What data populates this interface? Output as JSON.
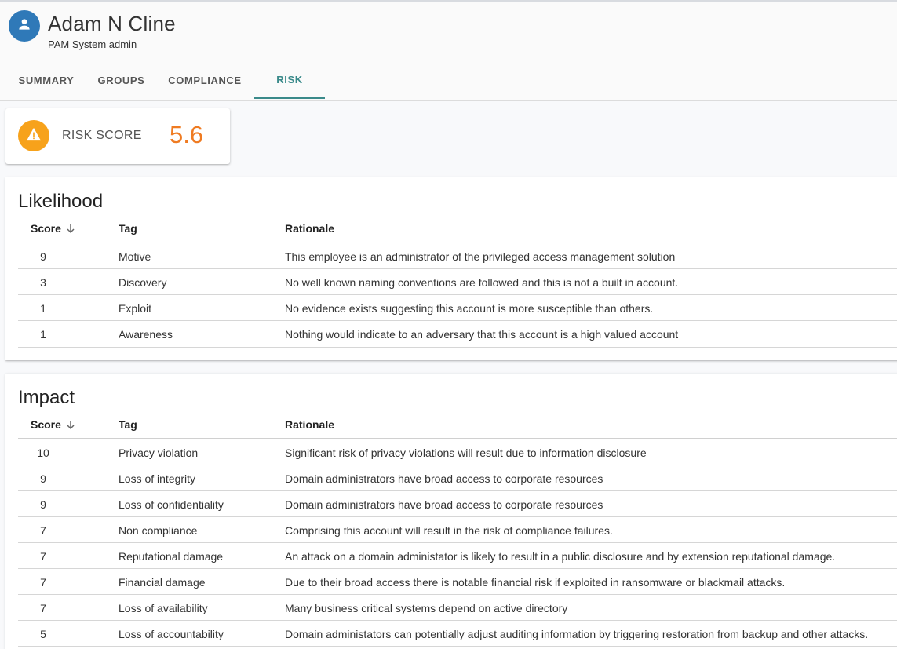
{
  "user": {
    "name": "Adam N Cline",
    "role": "PAM System admin",
    "avatar_icon": "person-icon",
    "avatar_color": "#2f79b8"
  },
  "tabs": [
    {
      "label": "SUMMARY",
      "active": false
    },
    {
      "label": "GROUPS",
      "active": false
    },
    {
      "label": "COMPLIANCE",
      "active": false
    },
    {
      "label": "RISK",
      "active": true
    }
  ],
  "risk": {
    "label": "RISK SCORE",
    "value": "5.6",
    "icon": "warning-icon",
    "icon_color": "#f7a21b",
    "value_color": "#ef7b22"
  },
  "likelihood": {
    "title": "Likelihood",
    "columns": {
      "score": "Score",
      "tag": "Tag",
      "rationale": "Rationale"
    },
    "rows": [
      {
        "score": "9",
        "tag": "Motive",
        "rationale": "This employee is an administrator of the privileged access management solution"
      },
      {
        "score": "3",
        "tag": "Discovery",
        "rationale": "No well known naming conventions are followed and this is not a built in account."
      },
      {
        "score": "1",
        "tag": "Exploit",
        "rationale": "No evidence exists suggesting this account is more susceptible than others."
      },
      {
        "score": "1",
        "tag": "Awareness",
        "rationale": "Nothing would indicate to an adversary that this account is a high valued account"
      }
    ]
  },
  "impact": {
    "title": "Impact",
    "columns": {
      "score": "Score",
      "tag": "Tag",
      "rationale": "Rationale"
    },
    "rows": [
      {
        "score": "10",
        "tag": "Privacy violation",
        "rationale": "Significant risk of privacy violations will result due to information disclosure"
      },
      {
        "score": "9",
        "tag": "Loss of integrity",
        "rationale": "Domain administrators have broad access to corporate resources"
      },
      {
        "score": "9",
        "tag": "Loss of confidentiality",
        "rationale": "Domain administrators have broad access to corporate resources"
      },
      {
        "score": "7",
        "tag": "Non compliance",
        "rationale": "Comprising this account will result in the risk of compliance failures."
      },
      {
        "score": "7",
        "tag": "Reputational damage",
        "rationale": "An attack on a domain administator is likely to result in a public disclosure and by extension reputational damage."
      },
      {
        "score": "7",
        "tag": "Financial damage",
        "rationale": "Due to their broad access there is notable financial risk if exploited in ransomware or blackmail attacks."
      },
      {
        "score": "7",
        "tag": "Loss of availability",
        "rationale": "Many business critical systems depend on active directory"
      },
      {
        "score": "5",
        "tag": "Loss of accountability",
        "rationale": "Domain administators can potentially adjust auditing information by triggering restoration from backup and other attacks."
      }
    ]
  }
}
